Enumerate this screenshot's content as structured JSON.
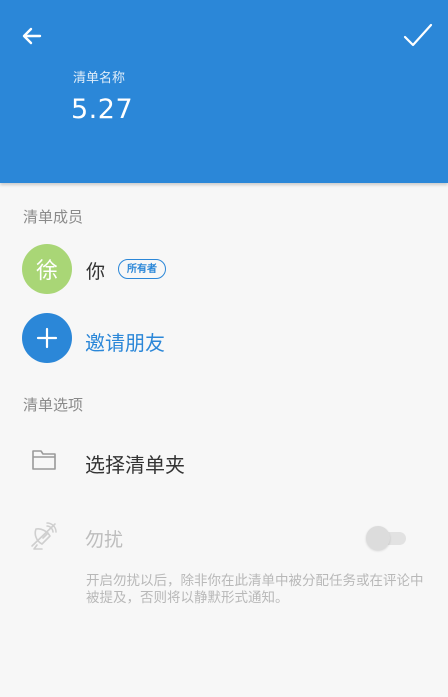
{
  "header": {
    "list_name_label": "清单名称",
    "list_name_value": "5.27",
    "back_icon": "arrow-left-icon",
    "confirm_icon": "checkmark-icon"
  },
  "members": {
    "section_title": "清单成员",
    "items": [
      {
        "avatar_text": "徐",
        "name": "你",
        "badge": "所有者"
      }
    ],
    "invite_label": "邀请朋友",
    "invite_icon": "plus-icon"
  },
  "options": {
    "section_title": "清单选项",
    "folder_label": "选择清单夹",
    "folder_icon": "folder-icon",
    "dnd_label": "勿扰",
    "dnd_icon": "muted-broadcast-icon",
    "dnd_enabled": false,
    "dnd_description": "开启勿扰以后，除非你在此清单中被分配任务或在评论中被提及，否则将以静默形式通知。"
  },
  "colors": {
    "accent": "#2b87d8",
    "avatar_bg": "#a9d676",
    "background": "#f7f7f7"
  }
}
